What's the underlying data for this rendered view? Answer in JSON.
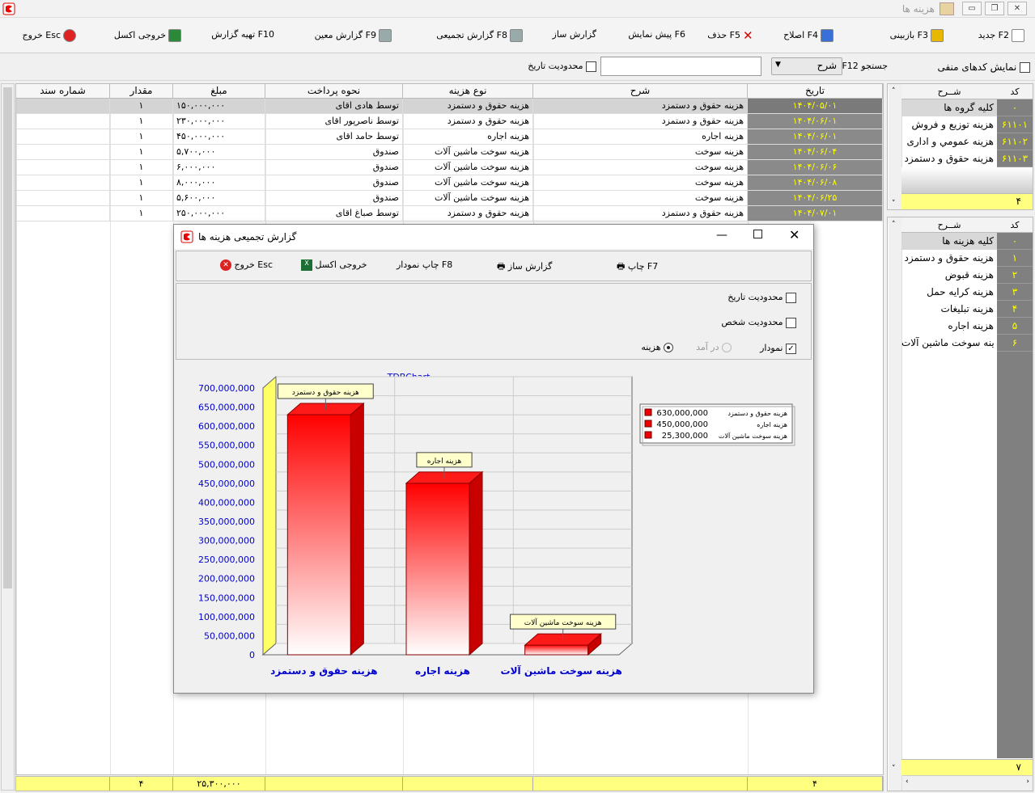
{
  "window": {
    "title": "هزینه ها"
  },
  "toolbar": [
    {
      "label": "جدید F2",
      "icon": "document-icon",
      "right": 10
    },
    {
      "label": "بازبینی F3",
      "icon": "glasses-icon",
      "right": 110
    },
    {
      "label": "اصلاح F4",
      "icon": "pencil-icon",
      "right": 246
    },
    {
      "label": "حذف F5",
      "icon": "delete-x-icon",
      "right": 342
    },
    {
      "label": "پیش نمایش F6",
      "icon": "",
      "right": 432
    },
    {
      "label": "گزارش ساز",
      "icon": "",
      "right": 542
    },
    {
      "label": "گزارش تجمیعی F8",
      "icon": "printer-icon",
      "right": 630
    },
    {
      "label": "گزارش معین F9",
      "icon": "printer-icon",
      "right": 792
    },
    {
      "label": "تهیه گزارش F10",
      "icon": "",
      "right": 940
    },
    {
      "label": "خروجی اکسل",
      "icon": "excel-icon",
      "right": 1052
    },
    {
      "label": "خروج Esc",
      "icon": "exit-icon",
      "right": 1182
    }
  ],
  "filter": {
    "negative_codes": "نمایش کدهای منفی",
    "search_label": "F12 جستجو",
    "search_field": "شرح",
    "date_limit": "محدودیت تاریخ",
    "search_value": ""
  },
  "grid": {
    "headers": [
      "تاریخ",
      "شرح",
      "نوع هزینه",
      "نحوه پرداخت",
      "مبلغ",
      "مقدار",
      "شماره سند"
    ],
    "rows": [
      [
        "۱۴۰۴/۰۵/۰۱",
        "هزینه حقوق و دستمزد",
        "هزینه حقوق و دستمزد",
        "توسط هادی اقای",
        "۱۵۰,۰۰۰,۰۰۰",
        "۱",
        ""
      ],
      [
        "۱۴۰۴/۰۶/۰۱",
        "هزینه حقوق و دستمزد",
        "هزینه حقوق و دستمزد",
        "توسط ناصرپور اقای",
        "۲۳۰,۰۰۰,۰۰۰",
        "۱",
        ""
      ],
      [
        "۱۴۰۴/۰۶/۰۱",
        "هزینه اجاره",
        "هزینه اجاره",
        "توسط حامد اقای",
        "۴۵۰,۰۰۰,۰۰۰",
        "۱",
        ""
      ],
      [
        "۱۴۰۴/۰۶/۰۴",
        "هزینه سوخت",
        "هزینه سوخت ماشین آلات",
        "صندوق",
        "۵,۷۰۰,۰۰۰",
        "۱",
        ""
      ],
      [
        "۱۴۰۴/۰۶/۰۶",
        "هزینه سوخت",
        "هزینه سوخت ماشین آلات",
        "صندوق",
        "۶,۰۰۰,۰۰۰",
        "۱",
        ""
      ],
      [
        "۱۴۰۴/۰۶/۰۸",
        "هزینه سوخت",
        "هزینه سوخت ماشین آلات",
        "صندوق",
        "۸,۰۰۰,۰۰۰",
        "۱",
        ""
      ],
      [
        "۱۴۰۴/۰۶/۲۵",
        "هزینه سوخت",
        "هزینه سوخت ماشین آلات",
        "صندوق",
        "۵,۶۰۰,۰۰۰",
        "۱",
        ""
      ],
      [
        "۱۴۰۴/۰۷/۰۱",
        "هزینه حقوق و دستمزد",
        "هزینه حقوق و دستمزد",
        "توسط صباغ اقای",
        "۲۵۰,۰۰۰,۰۰۰",
        "۱",
        ""
      ]
    ],
    "totals": {
      "date_count": "۴",
      "amount": "۲۵,۳۰۰,۰۰۰",
      "qty": "۴"
    }
  },
  "groups": {
    "headers": {
      "code": "کد",
      "desc": "شــرح"
    },
    "items": [
      {
        "code": "۰",
        "name": "کلیه گروه ها"
      },
      {
        "code": "۶۱۱۰۱",
        "name": "هزینه توزیع و فروش"
      },
      {
        "code": "۶۱۱۰۲",
        "name": "هزینه عمومي و اداری"
      },
      {
        "code": "۶۱۱۰۳",
        "name": "هزینه حقوق و دستمزد"
      }
    ],
    "count": "۴"
  },
  "types": {
    "headers": {
      "code": "کد",
      "desc": "شــرح"
    },
    "items": [
      {
        "code": "۰",
        "name": "کلیه هزینه ها"
      },
      {
        "code": "۱",
        "name": "هزینه حقوق و دستمزد"
      },
      {
        "code": "۲",
        "name": "هزینه قبوض"
      },
      {
        "code": "۳",
        "name": "هزینه کرایه حمل"
      },
      {
        "code": "۴",
        "name": "هزینه تبلیغات"
      },
      {
        "code": "۵",
        "name": "هزینه اجاره"
      },
      {
        "code": "۶",
        "name": "هزینه سوخت ماشین آلات"
      }
    ],
    "count": "۷"
  },
  "dialog": {
    "title": "گزارش تجمیعی هزینه ها",
    "buttons": {
      "print": "چاپ F7",
      "report_builder": "گزارش ساز",
      "print_chart": "چاپ نمودار F8",
      "excel": "خروجی اکسل",
      "exit": "خروج Esc"
    },
    "options": {
      "date_limit": "محدودیت تاریخ",
      "person_limit": "محدودیت شخص",
      "chart": "نمودار",
      "income": "در آمد",
      "expense": "هزینه"
    }
  },
  "chart_data": {
    "type": "bar",
    "title": "TDBChart",
    "categories": [
      "هزینه حقوق و دستمزد",
      "هزینه اجاره",
      "هزینه سوخت ماشین آلات"
    ],
    "values": [
      630000000,
      450000000,
      25300000
    ],
    "value_labels": [
      "630,000,000",
      "450,000,000",
      "25,300,000"
    ],
    "ylim": [
      0,
      700000000
    ],
    "yticks": [
      "0",
      "50,000,000",
      "100,000,000",
      "150,000,000",
      "200,000,000",
      "250,000,000",
      "300,000,000",
      "350,000,000",
      "400,000,000",
      "450,000,000",
      "500,000,000",
      "550,000,000",
      "600,000,000",
      "650,000,000",
      "700,000,000"
    ],
    "legend": "top-right",
    "grid": true,
    "colors": {
      "bar": "#ff0000",
      "axis_text": "#0000cc",
      "wall": "#ffff66"
    }
  }
}
